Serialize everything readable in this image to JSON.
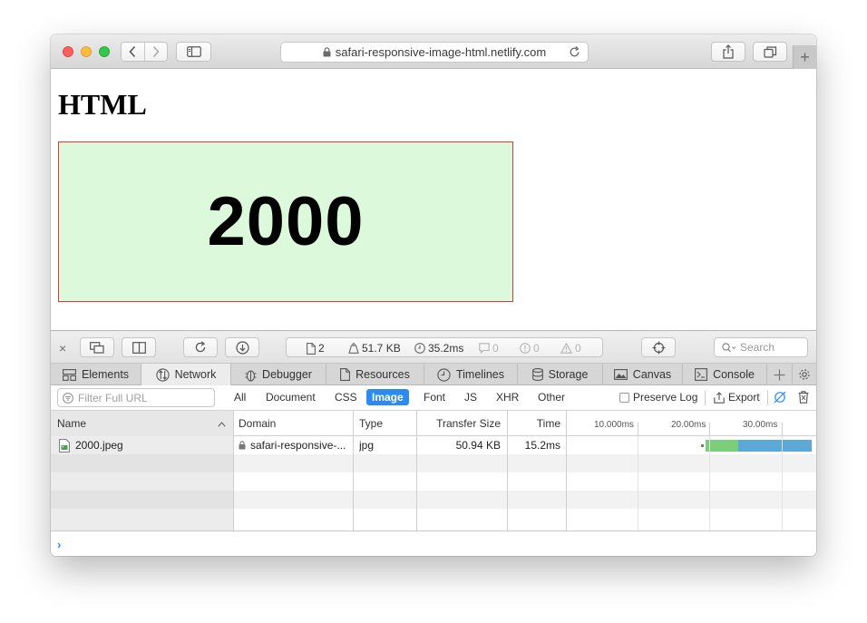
{
  "browser": {
    "url": "safari-responsive-image-html.netlify.com",
    "new_tab_label": "+"
  },
  "page": {
    "heading": "HTML",
    "image_text": "2000",
    "image_bg": "#dcfadb",
    "image_border": "#d43c3c"
  },
  "devtools": {
    "close_label": "×",
    "stats": {
      "resources": "2",
      "size": "51.7 KB",
      "time": "35.2ms",
      "logs": "0",
      "errors": "0",
      "warnings": "0"
    },
    "search_placeholder": "Search",
    "tabs": [
      {
        "label": "Elements",
        "icon": "elements-icon"
      },
      {
        "label": "Network",
        "icon": "network-icon"
      },
      {
        "label": "Debugger",
        "icon": "debugger-icon"
      },
      {
        "label": "Resources",
        "icon": "resources-icon"
      },
      {
        "label": "Timelines",
        "icon": "timelines-icon"
      },
      {
        "label": "Storage",
        "icon": "storage-icon"
      },
      {
        "label": "Canvas",
        "icon": "canvas-icon"
      },
      {
        "label": "Console",
        "icon": "console-icon"
      }
    ],
    "active_tab": "Network",
    "filter": {
      "placeholder": "Filter Full URL",
      "types": [
        "All",
        "Document",
        "CSS",
        "Image",
        "Font",
        "JS",
        "XHR",
        "Other"
      ],
      "active_type": "Image",
      "preserve_log_label": "Preserve Log",
      "export_label": "Export"
    },
    "table": {
      "columns": {
        "name": "Name",
        "domain": "Domain",
        "type": "Type",
        "transfer_size": "Transfer Size",
        "time": "Time"
      },
      "timeline_ticks": [
        "10.000ms",
        "20.00ms",
        "30.00ms"
      ],
      "rows": [
        {
          "name": "2000.jpeg",
          "domain": "safari-responsive-...",
          "type": "jpg",
          "transfer_size": "50.94 KB",
          "time": "15.2ms"
        }
      ]
    },
    "console_prompt": "›",
    "accent": "#2d8bf0"
  }
}
